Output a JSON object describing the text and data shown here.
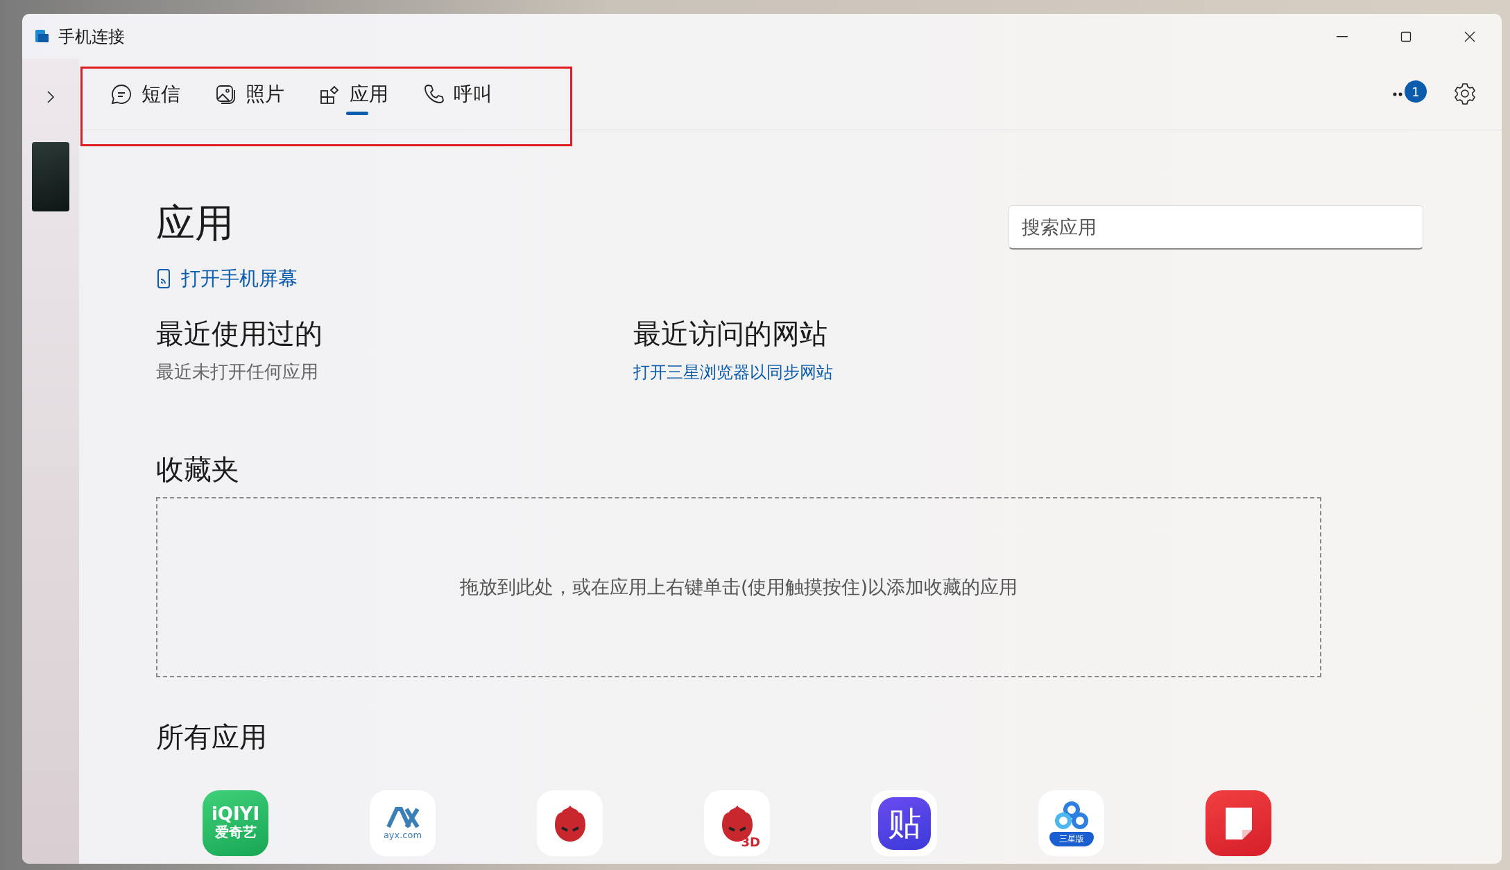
{
  "window": {
    "title": "手机连接"
  },
  "tabs": [
    {
      "label": "短信",
      "selected": false
    },
    {
      "label": "照片",
      "selected": false
    },
    {
      "label": "应用",
      "selected": true
    },
    {
      "label": "呼叫",
      "selected": false
    }
  ],
  "notification_badge": "1",
  "page": {
    "title": "应用",
    "open_screen_link": "打开手机屏幕",
    "search": {
      "placeholder": "搜索应用"
    }
  },
  "recent_apps": {
    "title": "最近使用过的",
    "empty_text": "最近未打开任何应用"
  },
  "recent_sites": {
    "title": "最近访问的网站",
    "link": "打开三星浏览器以同步网站"
  },
  "favorites": {
    "title": "收藏夹",
    "drop_hint": "拖放到此处，或在应用上右键单击(使用触摸按住)以添加收藏的应用"
  },
  "all_apps": {
    "title": "所有应用",
    "apps": [
      {
        "kind": "iqiyi",
        "logo_text": [
          "iQIYI",
          "爱奇艺"
        ]
      },
      {
        "kind": "ayx",
        "logo_text": [
          "ayx.com"
        ]
      },
      {
        "kind": "antutu"
      },
      {
        "kind": "antutu3d",
        "logo_text": [
          "3D"
        ]
      },
      {
        "kind": "tieba",
        "logo_text": [
          "贴"
        ]
      },
      {
        "kind": "baidu",
        "logo_text": [
          "三星版"
        ]
      },
      {
        "kind": "notes"
      }
    ]
  }
}
